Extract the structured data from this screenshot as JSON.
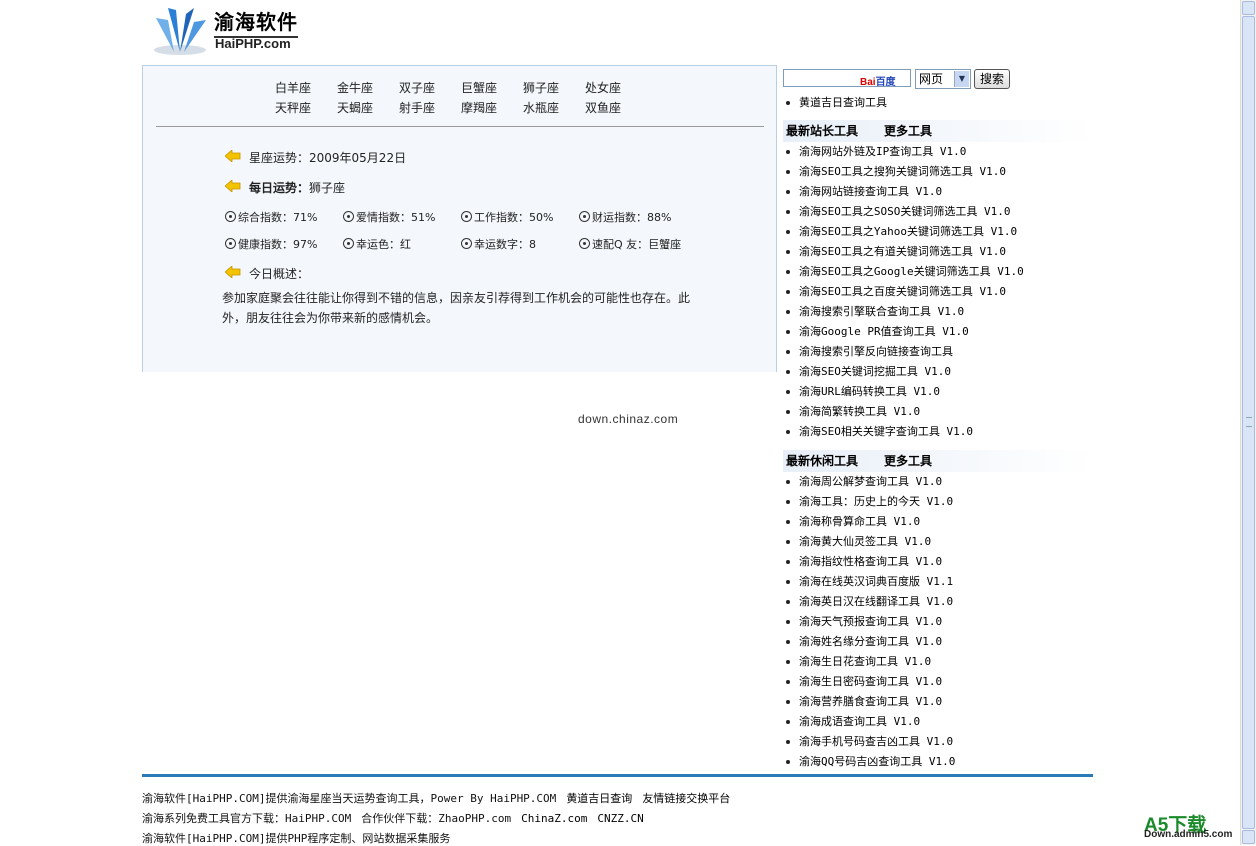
{
  "logo": {
    "title": "渝海软件",
    "subtitle": "HaiPHP.com"
  },
  "zodiac_nav": {
    "row1": [
      "白羊座",
      "金牛座",
      "双子座",
      "巨蟹座",
      "狮子座",
      "处女座"
    ],
    "row2": [
      "天秤座",
      "天蝎座",
      "射手座",
      "摩羯座",
      "水瓶座",
      "双鱼座"
    ]
  },
  "fortune": {
    "date_label": "星座运势：2009年05月22日",
    "daily_label": "每日运势：",
    "daily_sign": "狮子座",
    "indices_row1": [
      "综合指数：71%",
      "爱情指数：51%",
      "工作指数：50%",
      "财运指数：88%"
    ],
    "indices_row2": [
      "健康指数：97%",
      "幸运色：红",
      "幸运数字：8",
      "速配Q 友：巨蟹座"
    ],
    "summary_label": "今日概述：",
    "summary_text": "参加家庭聚会往往能让你得到不错的信息，因亲友引荐得到工作机会的可能性也存在。此外，朋友往往会为你带来新的感情机会。"
  },
  "watermark_mid": "down.chinaz.com",
  "search": {
    "baidu_red": "Bai",
    "baidu_blue": "百度",
    "select_value": "网页",
    "button_label": "搜索",
    "extra_link": "黄道吉日查询工具"
  },
  "webmaster_tools": {
    "title": "最新站长工具",
    "more": "更多工具",
    "items": [
      "渝海网站外链及IP查询工具 V1.0",
      "渝海SEO工具之搜狗关键词筛选工具 V1.0",
      "渝海网站链接查询工具 V1.0",
      "渝海SEO工具之SOSO关键词筛选工具 V1.0",
      "渝海SEO工具之Yahoo关键词筛选工具 V1.0",
      "渝海SEO工具之有道关键词筛选工具 V1.0",
      "渝海SEO工具之Google关键词筛选工具 V1.0",
      "渝海SEO工具之百度关键词筛选工具 V1.0",
      "渝海搜索引擎联合查询工具 V1.0",
      "渝海Google PR值查询工具 V1.0",
      "渝海搜索引擎反向链接查询工具",
      "渝海SEO关键词挖掘工具 V1.0",
      "渝海URL编码转换工具 V1.0",
      "渝海简繁转换工具 V1.0",
      "渝海SEO相关关键字查询工具 V1.0"
    ]
  },
  "leisure_tools": {
    "title": "最新休闲工具",
    "more": "更多工具",
    "items": [
      "渝海周公解梦查询工具 V1.0",
      "渝海工具：历史上的今天 V1.0",
      "渝海称骨算命工具 V1.0",
      "渝海黄大仙灵签工具 V1.0",
      "渝海指纹性格查询工具 V1.0",
      "渝海在线英汉词典百度版 V1.1",
      "渝海英日汉在线翻译工具 V1.0",
      "渝海天气预报查询工具 V1.0",
      "渝海姓名缘分查询工具 V1.0",
      "渝海生日花查询工具 V1.0",
      "渝海生日密码查询工具 V1.0",
      "渝海营养膳食查询工具 V1.0",
      "渝海成语查询工具 V1.0",
      "渝海手机号码查吉凶工具 V1.0",
      "渝海QQ号码吉凶查询工具 V1.0"
    ]
  },
  "footer": {
    "line1_text": "渝海软件[HaiPHP.COM]提供渝海星座当天运势查询工具，Power By HaiPHP.COM",
    "line1_link1": "黄道吉日查询",
    "line1_link2": "友情链接交换平台",
    "line2_text": "渝海系列免费工具官方下载：HaiPHP.COM",
    "line2_partner": "合作伙伴下载：ZhaoPHP.com",
    "line2_link1": "ChinaZ.com",
    "line2_link2": "CNZZ.CN",
    "line3_text": "渝海软件[HaiPHP.COM]提供PHP程序定制、网站数据采集服务"
  },
  "a5_watermark": {
    "logo": "A5下载",
    "sub": "Down.admin5.com"
  },
  "colors": {
    "accent_blue": "#2a7ab8",
    "panel_bg": "#f4f8fc",
    "panel_border": "#b8cfe4"
  }
}
